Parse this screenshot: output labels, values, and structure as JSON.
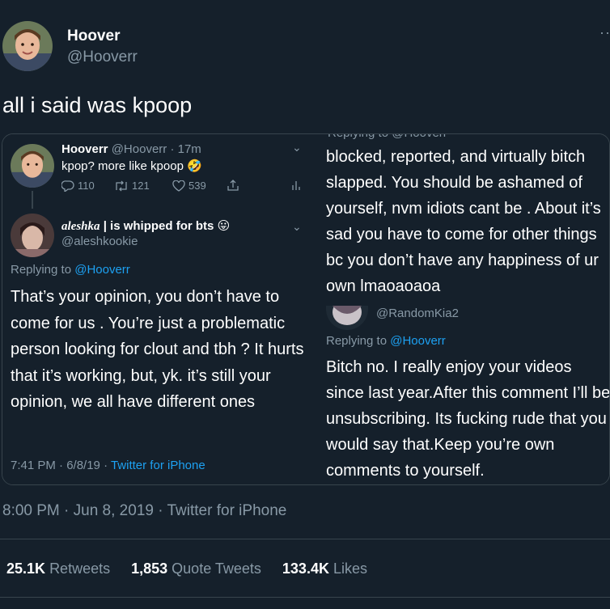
{
  "header": {
    "name": "Hoover",
    "handle": "@Hooverr",
    "more_icon": "more-dots-icon"
  },
  "tweet": {
    "text": "all i said was kpoop"
  },
  "screenshot": {
    "left": {
      "tweet1": {
        "name": "Hooverr",
        "handle_time": "@Hooverr · 17m",
        "text": "kpop? more like kpoop",
        "emoji": "🤣",
        "reply_count": "110",
        "retweet_count": "121",
        "like_count": "539"
      },
      "tweet2": {
        "name": "aleshka",
        "name_suffix": "| is whipped for bts",
        "emoji": "😛",
        "handle": "@aleshkookie",
        "replying_prefix": "Replying to",
        "replying_handle": "@Hooverr",
        "body": "That’s your opinion, you don’t have to come for us . You’re just a problematic person looking for clout and tbh ? It hurts that it’s working, but, yk. it’s still your opinion, we all have different ones",
        "time_date": "7:41 PM · 6/8/19 · ",
        "client": "Twitter for iPhone"
      }
    },
    "right": {
      "cut_text": "Replying to @Hooverr",
      "body1": "blocked, reported, and virtually bitch slapped. You should be ashamed of yourself, nvm idiots cant be . About it’s sad you have to come for other things bc you don’t have any happiness of ur own lmaoaoaoa",
      "handle": "@RandomKia2",
      "replying_prefix": "Replying to",
      "replying_handle": "@Hooverr",
      "body2": "Bitch no. I really enjoy your videos since last year.After this comment I’ll be unsubscribing. Its fucking rude that you would say that.Keep you’re own comments to yourself."
    }
  },
  "meta": {
    "time_date": "8:00 PM · Jun 8, 2019 · ",
    "client": "Twitter for iPhone"
  },
  "stats": {
    "retweets_count": "25.1K",
    "retweets_label": "Retweets",
    "quotes_count": "1,853",
    "quotes_label": "Quote Tweets",
    "likes_count": "133.4K",
    "likes_label": "Likes"
  },
  "colors": {
    "background": "#15202b",
    "muted": "#8899a6",
    "link": "#1da1f2",
    "border": "#38444d"
  }
}
